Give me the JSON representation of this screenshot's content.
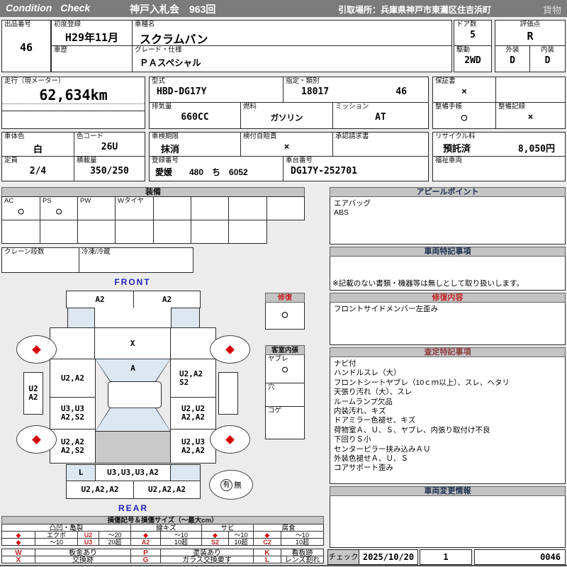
{
  "header": {
    "brand": "Condition Check",
    "auction": "神戸入札会　963回",
    "pickup": "引取場所：兵庫県神戸市東灘区住吉浜町",
    "category": "貨物"
  },
  "info": {
    "lot_label": "出品番号",
    "lot_value": "46",
    "first_reg_label": "初度登録",
    "first_reg_value": "H29年11月",
    "model_name_label": "車種名",
    "model_name_value": "スクラムバン",
    "history_label": "車歴",
    "history_value": "",
    "grade_label": "グレード・仕様",
    "grade_value": "ＰＡスペシャル",
    "doors_label": "ドア数",
    "doors_value": "5",
    "drive_label": "駆動",
    "drive_value": "2WD",
    "score_label": "評価点",
    "score_value": "R",
    "exterior_label": "外装",
    "exterior_value": "D",
    "interior_label": "内装",
    "interior_value": "D",
    "mileage_label": "走行（現メーター）",
    "mileage_value": "62,634km",
    "model_code_label": "型式",
    "model_code_value": "HBD-DG17Y",
    "class_label": "指定・類別",
    "class_value1": "18017",
    "class_value2": "46",
    "displacement_label": "排気量",
    "displacement_value": "660CC",
    "fuel_label": "燃料",
    "fuel_value": "ガソリン",
    "mission_label": "ミッション",
    "mission_value": "AT",
    "warranty_label": "保証書",
    "warranty_value": "×",
    "maintenance_book_label": "整備手帳",
    "maintenance_book_value": "○",
    "maintenance_record_label": "整備記録",
    "maintenance_record_value": "×",
    "body_color_label": "車体色",
    "body_color_value": "白",
    "color_code_label": "色コード",
    "color_code_value": "26U",
    "capacity_label": "定員",
    "capacity_value": "2/4",
    "load_label": "積載量",
    "load_value": "350/250",
    "inspection_label": "車検期限",
    "inspection_value": "抹消",
    "insurance_label": "検付自賠責",
    "insurance_value": "×",
    "approval_label": "承認請求書",
    "approval_value": "",
    "recycle_label": "リサイクル料",
    "recycle_status": "預託済",
    "recycle_fee": "8,050円",
    "reg_number_label": "登録番号",
    "reg_number_value": "愛媛　　480　ち　6052",
    "chassis_label": "車台番号",
    "chassis_value": "DG17Y-252701",
    "welfare_label": "福祉車両",
    "welfare_value": ""
  },
  "equipment": {
    "title": "装備",
    "items": [
      {
        "label": "AC",
        "value": "○"
      },
      {
        "label": "PS",
        "value": "○"
      },
      {
        "label": "PW",
        "value": ""
      },
      {
        "label": "Wタイヤ",
        "value": ""
      },
      {
        "label": "",
        "value": ""
      },
      {
        "label": "",
        "value": ""
      },
      {
        "label": "",
        "value": ""
      },
      {
        "label": "",
        "value": ""
      }
    ],
    "crane_label": "クレーン段数",
    "crane_value": "",
    "fridge_label": "冷凍/冷蔵",
    "fridge_value": ""
  },
  "diagram": {
    "front_label": "FRONT",
    "rear_label": "REAR",
    "front_bumper": [
      "A2",
      "A2"
    ],
    "hood": "X",
    "windshield": "A",
    "front_door_left": [
      "U2,A2"
    ],
    "front_door_right": [
      "U2,A2",
      "S2"
    ],
    "left_sill": [
      "U2",
      "A2"
    ],
    "slide_door_left": [
      "U3,U3",
      "A2,S2"
    ],
    "slide_door_right": [
      "U2,U2",
      "A2,A2"
    ],
    "quarter_left": [
      "U2,A2",
      "A2,S2"
    ],
    "quarter_right": [
      "U2,U3",
      "A2,A2"
    ],
    "rear_corner_left": "L",
    "rear_gate": "U3,U3,U3,A2",
    "rear_bumper": [
      "U2,A2,A2",
      "U2,A2,A2"
    ],
    "spare": {
      "yes": "有",
      "no": "無"
    },
    "repair_legend": {
      "title": "修復",
      "value": "○"
    },
    "cabin_legend": {
      "title": "客室内張",
      "rows": [
        {
          "label": "ヤブレ",
          "value": "○"
        },
        {
          "label": "穴",
          "value": ""
        },
        {
          "label": "コゲ",
          "value": ""
        }
      ]
    }
  },
  "panels": {
    "appeal": {
      "title": "アピールポイント",
      "lines": [
        "エアバッグ",
        "ABS"
      ]
    },
    "notes": {
      "title": "車両特記事項",
      "note": "※記載のない書類・機器等は無しとして取り扱いします。"
    },
    "repair": {
      "title": "修復内容",
      "lines": [
        "フロントサイドメンバー左歪み"
      ]
    },
    "assessment": {
      "title": "査定特記事項",
      "lines": [
        "ナビ付",
        "ハンドルスレ（大）",
        "フロントシートヤブレ（10ｃｍ以上）、スレ、ヘタリ",
        "天張り汚れ（大）、スレ",
        "ルームランプ欠品",
        "内装汚れ、キズ",
        "ドアミラー色褪せ、キズ",
        "荷物室Ａ、Ｕ、Ｓ、ヤブレ、内張り取付け不良",
        "下回りＳ小",
        "センターピラー挟み込みＡＵ",
        "外装色褪せＡ、Ｕ、Ｓ",
        "コアサポート歪み"
      ]
    },
    "change": {
      "title": "車両変更情報"
    }
  },
  "check": {
    "label": "チェック",
    "date": "2025/10/20",
    "count": "1",
    "code": "0046"
  },
  "legend": {
    "title": "損傷記号＆損傷サイズ（〜最大cm）",
    "col_headers": [
      "凸凹・亀裂",
      "線キズ",
      "サビ",
      "腐食"
    ],
    "row1": [
      "◆",
      "エクボ",
      "U2",
      "〜20",
      "◆",
      "〜10",
      "◆",
      "〜10",
      "◆",
      "〜10"
    ],
    "row2": [
      "◆",
      "〜10",
      "U3",
      "20超",
      "A2",
      "10超",
      "S2",
      "10超",
      "C2",
      "10超"
    ],
    "codes": [
      {
        "code": "W",
        "desc": "板金あり"
      },
      {
        "code": "X",
        "desc": "交換跡"
      },
      {
        "code": "P",
        "desc": "塗装あり"
      },
      {
        "code": "G",
        "desc": "ガラス交換要す"
      },
      {
        "code": "K",
        "desc": "看板跡"
      },
      {
        "code": "L",
        "desc": "レンズ割れ"
      }
    ]
  },
  "colors": {
    "accent_blue": "#2222bb",
    "marker_red": "#d40000",
    "glass_blue": "#dde7f2",
    "cargo_gray": "#c9c9c9"
  }
}
